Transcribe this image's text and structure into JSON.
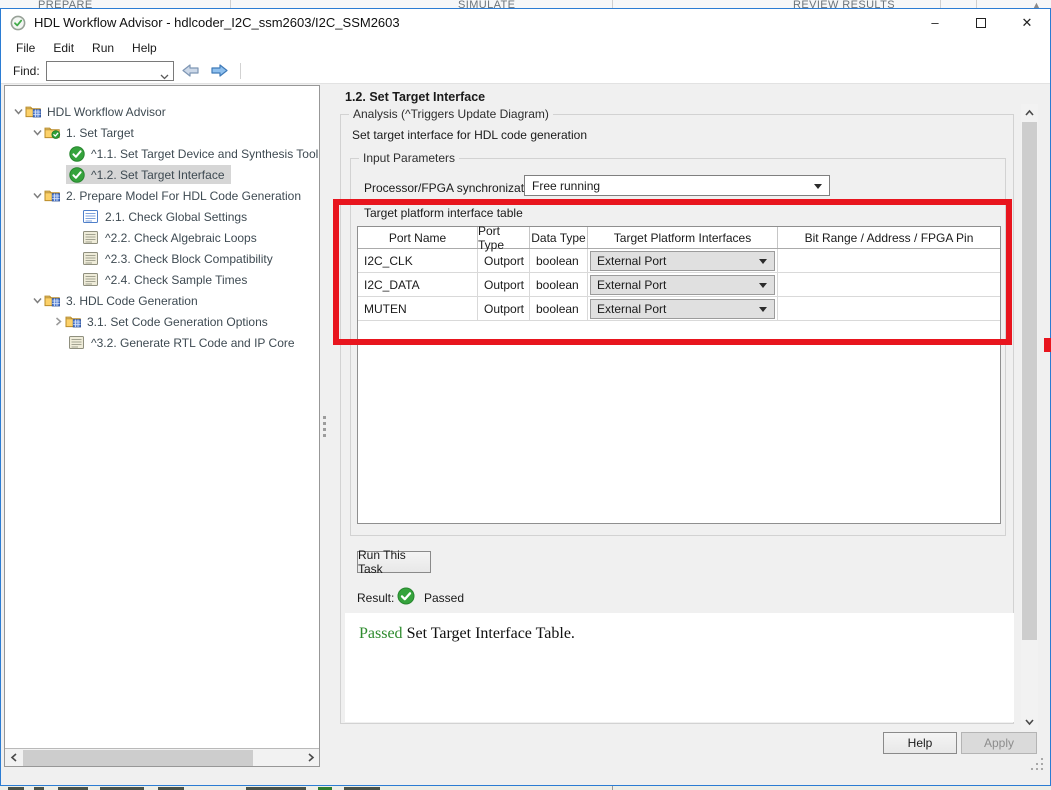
{
  "background": {
    "toolstrip_tabs": [
      "PREPARE",
      "SIMULATE",
      "REVIEW RESULTS"
    ]
  },
  "window": {
    "title": "HDL Workflow Advisor - hdlcoder_I2C_ssm2603/I2C_SSM2603",
    "controls": {
      "minimize": "–",
      "close": "✕"
    }
  },
  "menu": {
    "items": [
      "File",
      "Edit",
      "Run",
      "Help"
    ]
  },
  "toolbar": {
    "find_label": "Find:",
    "find_value": ""
  },
  "tree": {
    "items": [
      {
        "label": "HDL Workflow Advisor",
        "depth": 0,
        "icon": "folder",
        "chevron": "down",
        "selected": false
      },
      {
        "label": "1. Set Target",
        "depth": 1,
        "icon": "folder-check",
        "chevron": "down",
        "selected": false
      },
      {
        "label": "^1.1. Set Target Device and Synthesis Tool",
        "depth": 2,
        "icon": "check",
        "chevron": "none",
        "selected": false
      },
      {
        "label": "^1.2. Set Target Interface",
        "depth": 2,
        "icon": "check",
        "chevron": "none",
        "selected": true
      },
      {
        "label": "2. Prepare Model For HDL Code Generation",
        "depth": 1,
        "icon": "folder",
        "chevron": "down",
        "selected": false
      },
      {
        "label": "2.1. Check Global Settings",
        "depth": 2,
        "icon": "list-blue",
        "chevron": "none",
        "selected": false
      },
      {
        "label": "^2.2. Check Algebraic Loops",
        "depth": 2,
        "icon": "list",
        "chevron": "none",
        "selected": false
      },
      {
        "label": "^2.3. Check Block Compatibility",
        "depth": 2,
        "icon": "list",
        "chevron": "none",
        "selected": false
      },
      {
        "label": "^2.4. Check Sample Times",
        "depth": 2,
        "icon": "list",
        "chevron": "none",
        "selected": false
      },
      {
        "label": "3. HDL Code Generation",
        "depth": 1,
        "icon": "folder",
        "chevron": "down",
        "selected": false
      },
      {
        "label": "3.1. Set Code Generation Options",
        "depth": 2,
        "icon": "folder",
        "chevron": "right",
        "selected": false
      },
      {
        "label": "^3.2. Generate RTL Code and IP Core",
        "depth": 2,
        "icon": "list",
        "chevron": "none",
        "selected": false
      }
    ]
  },
  "panel": {
    "title": "1.2. Set Target Interface",
    "analysis_group_label": "Analysis (^Triggers Update Diagram)",
    "description": "Set target interface for HDL code generation",
    "input_group_label": "Input Parameters",
    "sync_label": "Processor/FPGA synchronization:",
    "sync_value": "Free running",
    "table_label": "Target platform interface table",
    "table": {
      "columns": [
        "Port Name",
        "Port Type",
        "Data Type",
        "Target Platform Interfaces",
        "Bit Range / Address / FPGA Pin"
      ],
      "rows": [
        {
          "port_name": "I2C_CLK",
          "port_type": "Outport",
          "data_type": "boolean",
          "interface": "External Port",
          "bit_range": ""
        },
        {
          "port_name": "I2C_DATA",
          "port_type": "Outport",
          "data_type": "boolean",
          "interface": "External Port",
          "bit_range": ""
        },
        {
          "port_name": "MUTEN",
          "port_type": "Outport",
          "data_type": "boolean",
          "interface": "External Port",
          "bit_range": ""
        }
      ]
    },
    "run_button": "Run This Task",
    "result_label": "Result:",
    "result_value": "Passed",
    "message": {
      "status": "Passed",
      "text": " Set Target Interface Table."
    },
    "help_button": "Help",
    "apply_button": "Apply"
  },
  "colors": {
    "annotation_red": "#e8151e",
    "status_green": "#2e9e3e",
    "selection_gray": "#d6d6d6",
    "window_border_blue": "#2b7cd3"
  }
}
